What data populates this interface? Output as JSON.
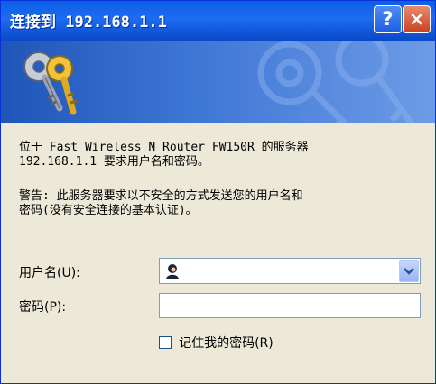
{
  "window": {
    "title": "连接到 192.168.1.1"
  },
  "titlebar": {
    "help_label": "?",
    "close_label": "×"
  },
  "message": {
    "line1": "位于 Fast Wireless N Router FW150R 的服务器\n192.168.1.1 要求用户名和密码。",
    "line2": "警告: 此服务器要求以不安全的方式发送您的用户名和\n密码(没有安全连接的基本认证)。"
  },
  "form": {
    "username_label": "用户名(U):",
    "username_value": "",
    "password_label": "密码(P):",
    "password_value": "",
    "remember_label": "记住我的密码(R)",
    "remember_checked": false
  },
  "icons": {
    "banner": "keys-icon",
    "help": "help-icon",
    "close": "close-icon",
    "user": "user-avatar-icon",
    "dropdown": "chevron-down-icon"
  },
  "colors": {
    "titlebar": "#0a5fe5",
    "banner": "#1f55b8",
    "close_button": "#c9411e",
    "dialog_bg": "#ece9d8"
  }
}
